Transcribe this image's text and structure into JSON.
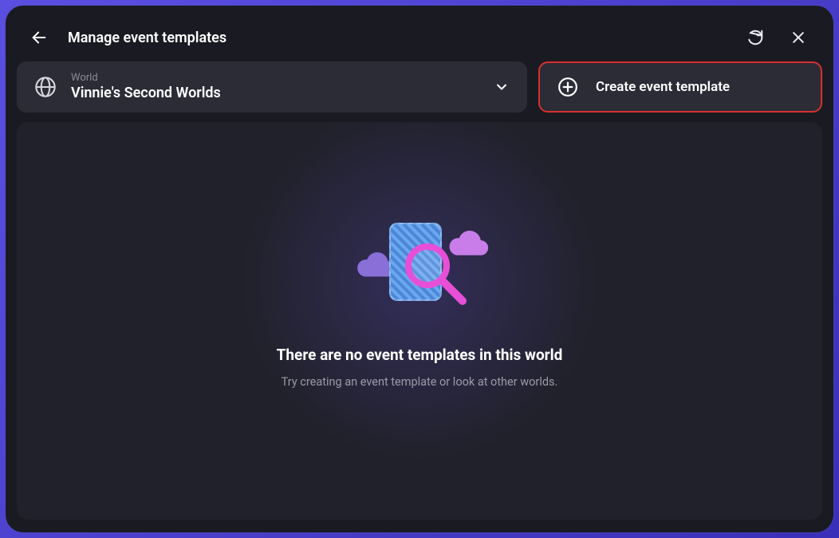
{
  "header": {
    "title": "Manage event templates"
  },
  "worldSelector": {
    "label": "World",
    "value": "Vinnie's Second Worlds"
  },
  "createButton": {
    "label": "Create event template"
  },
  "emptyState": {
    "title": "There are no event templates in this world",
    "subtitle": "Try creating an event template or look at other worlds."
  }
}
